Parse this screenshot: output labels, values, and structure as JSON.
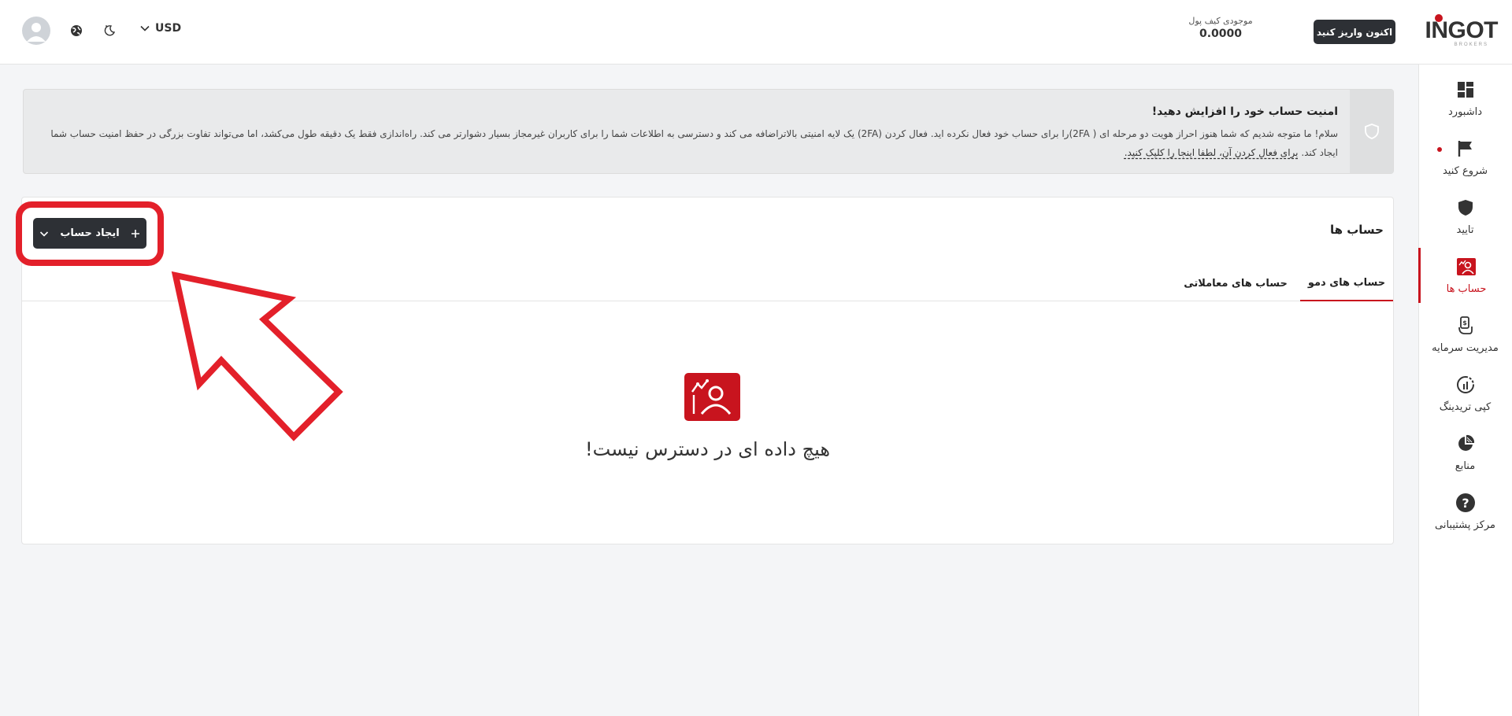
{
  "header": {
    "logo_text": "INGOT",
    "logo_sub": "BROKERS",
    "deposit_label": "اکنون واریز کنید",
    "wallet_label": "موجودی کیف پول",
    "wallet_value": "0.0000",
    "currency": "USD"
  },
  "sidebar": {
    "items": [
      {
        "label": "داشبورد",
        "icon": "dashboard-icon"
      },
      {
        "label": "شروع کنید",
        "icon": "flag-icon"
      },
      {
        "label": "تایید",
        "icon": "shield-icon"
      },
      {
        "label": "حساب ها",
        "icon": "accounts-icon"
      },
      {
        "label": "مدیریت سرمایه",
        "icon": "money-hand-icon"
      },
      {
        "label": "کپی تریدینگ",
        "icon": "copy-trading-icon"
      },
      {
        "label": "منابع",
        "icon": "pie-chart-icon"
      },
      {
        "label": "مرکز پشتیبانی",
        "icon": "help-icon"
      }
    ],
    "active_index": 3
  },
  "banner": {
    "title": "امنیت حساب خود را افزایش دهید!",
    "body": "سلام! ما متوجه شدیم که شما هنوز احراز هویت دو مرحله ای ( 2FA)را برای حساب خود فعال نکرده اید. فعال کردن (2FA) یک لایه امنیتی بالاتراضافه می کند و دسترسی به اطلاعات شما را برای کاربران غیرمجاز بسیار دشوارتر می کند. راه‌اندازی فقط یک دقیقه طول می‌کشد، اما می‌تواند تفاوت بزرگی در حفظ امنیت حساب شما ایجاد کند.",
    "link": "برای فعال کردن آن، لطفا اینجا را کلیک کنید."
  },
  "accounts": {
    "title": "حساب ها",
    "create_label": "ایجاد حساب",
    "tabs": [
      "حساب های دمو",
      "حساب های معاملاتی"
    ],
    "empty_text": "هیچ داده ای در دسترس نیست!"
  },
  "colors": {
    "brand_red": "#c8141e",
    "dark_button": "#2d3035",
    "annotation_red": "#e3202a"
  }
}
